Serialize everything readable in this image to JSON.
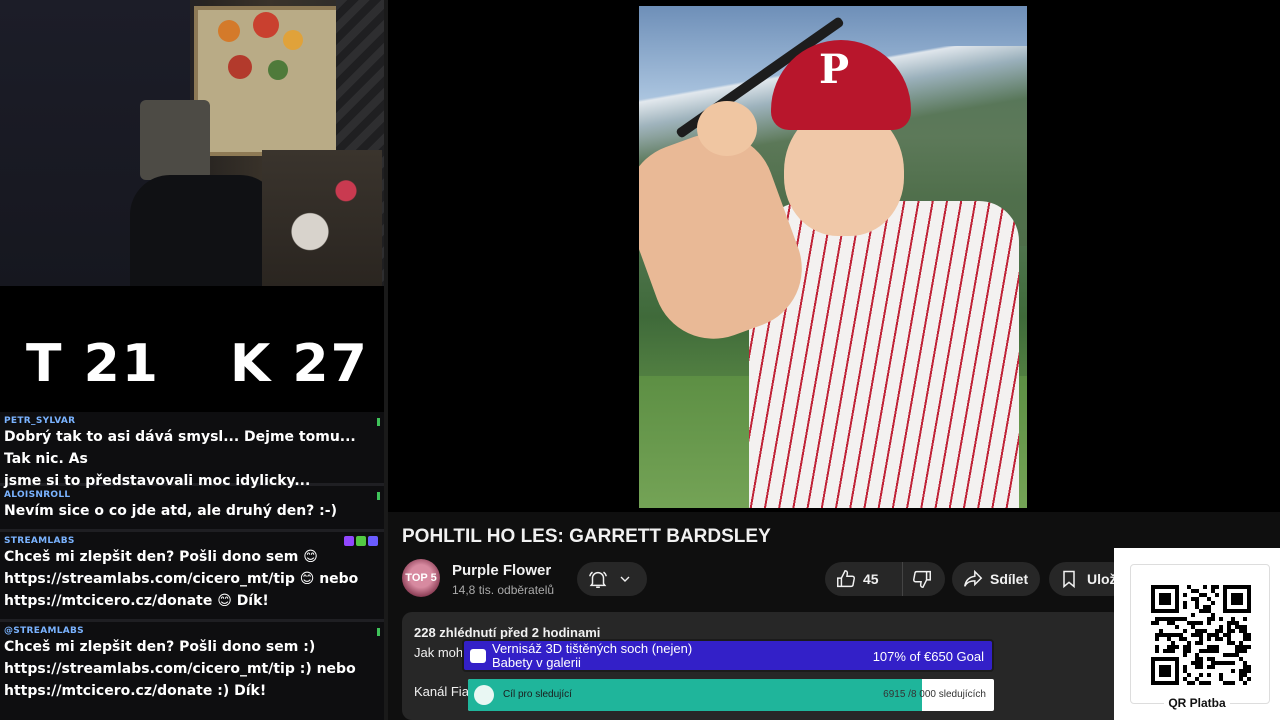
{
  "scoreboard": {
    "t": "T 21",
    "k": "K 27"
  },
  "chat": [
    {
      "user": "PETR_SYLVAR",
      "text": "Dobrý tak to asi dává smysl... Dejme tomu... Tak nic. As\njsme si to představovali moc idylicky..."
    },
    {
      "user": "ALOISNROLL",
      "text": "Nevím sice o co jde atd, ale druhý den? :-)"
    },
    {
      "user": "STREAMLABS",
      "text": "Chceš mi zlepšit den? Pošli dono sem 😊\nhttps://streamlabs.com/cicero_mt/tip 😊 nebo\nhttps://mtcicero.cz/donate 😊 Dík!"
    },
    {
      "user": "@STREAMLABS",
      "text": "Chceš mi zlepšit den? Pošli dono sem :)\nhttps://streamlabs.com/cicero_mt/tip :) nebo\nhttps://mtcicero.cz/donate :) Dík!"
    }
  ],
  "video": {
    "title": "POHLTIL HO LES: GARRETT BARDSLEY",
    "cap_logo": "P",
    "channel": {
      "name": "Purple Flower",
      "subscribers": "14,8 tis. odběratelů",
      "avatar_text": "TOP 5"
    },
    "likes": "45",
    "share_label": "Sdílet",
    "save_label": "Ulož",
    "views_and_date": "228 zhlédnutí  před 2 hodinami",
    "description_line1": "Jak moh",
    "description_line2": "Kanál Fia"
  },
  "overlays": {
    "goal": {
      "title": "Vernisáž 3D tištěných soch (nejen)\nBabety v galerii",
      "progress": "107% of €650 Goal",
      "color": "#3320c8"
    },
    "followers": {
      "label": "Cíl pro sledující",
      "count": "6915 /8 000 sledujících",
      "fraction": 0.864,
      "color": "#1fb59b"
    },
    "qr": {
      "label": "QR Platba"
    }
  },
  "icons": {
    "bell": "bell-icon",
    "chevron": "chevron-down-icon",
    "like": "thumbs-up-icon",
    "dislike": "thumbs-down-icon",
    "share": "share-arrow-icon",
    "save": "bookmark-icon"
  }
}
